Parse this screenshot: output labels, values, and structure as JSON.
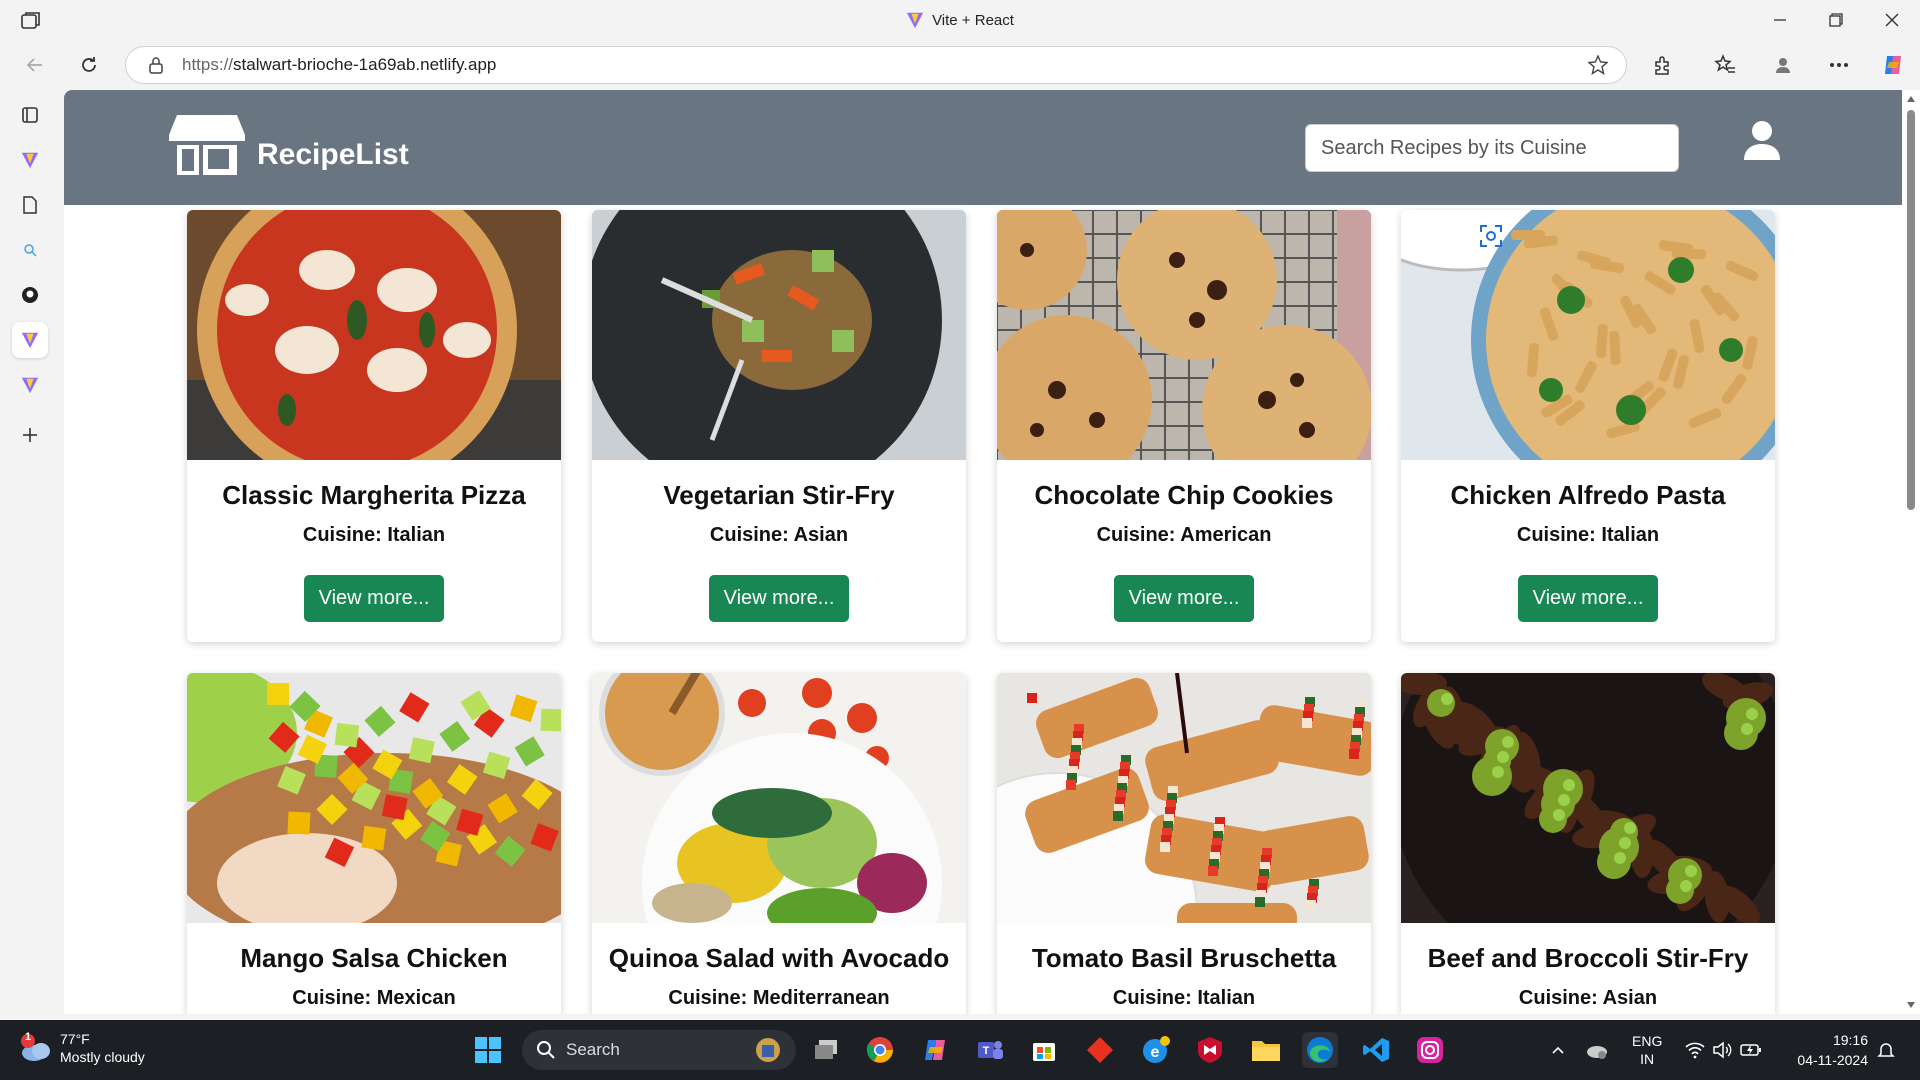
{
  "browser": {
    "window_title": "Vite + React",
    "url_protocol": "https://",
    "url_host": "stalwart-brioche-1a69ab.netlify.app"
  },
  "app": {
    "brand": "RecipeList",
    "search_placeholder": "Search Recipes by its Cuisine"
  },
  "cuisine_label": "Cuisine:",
  "view_more_label": "View more...",
  "recipes": [
    {
      "title": "Classic Margherita Pizza",
      "cuisine": "Cuisine: Italian",
      "image": "pizza"
    },
    {
      "title": "Vegetarian Stir-Fry",
      "cuisine": "Cuisine: Asian",
      "image": "stir-fry"
    },
    {
      "title": "Chocolate Chip Cookies",
      "cuisine": "Cuisine: American",
      "image": "cookies"
    },
    {
      "title": "Chicken Alfredo Pasta",
      "cuisine": "Cuisine: Italian",
      "image": "pasta"
    },
    {
      "title": "Mango Salsa Chicken",
      "cuisine": "Cuisine: Mexican",
      "image": "mango-chicken"
    },
    {
      "title": "Quinoa Salad with Avocado",
      "cuisine": "Cuisine: Mediterranean",
      "image": "quinoa-salad"
    },
    {
      "title": "Tomato Basil Bruschetta",
      "cuisine": "Cuisine: Italian",
      "image": "bruschetta"
    },
    {
      "title": "Beef and Broccoli Stir-Fry",
      "cuisine": "Cuisine: Asian",
      "image": "beef-broccoli"
    }
  ],
  "taskbar": {
    "weather_temp": "77°F",
    "weather_desc": "Mostly cloudy",
    "weather_badge": "1",
    "search_label": "Search",
    "lang_line1": "ENG",
    "lang_line2": "IN",
    "time": "19:16",
    "date": "04-11-2024"
  },
  "colors": {
    "header": "#697580",
    "button": "#198754"
  }
}
